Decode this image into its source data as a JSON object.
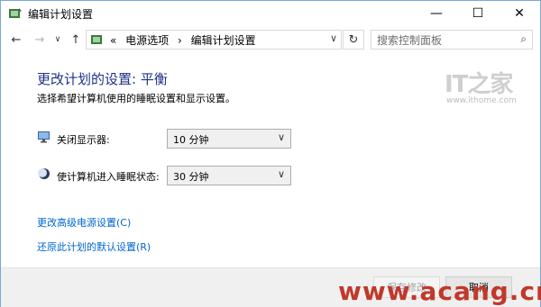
{
  "window": {
    "title": "编辑计划设置",
    "minimize_glyph": "—",
    "maximize_glyph": "☐",
    "close_glyph": "✕"
  },
  "nav": {
    "back": "←",
    "forward": "→",
    "recent": "∨",
    "up": "↑",
    "address_sep": "«",
    "crumb1": "电源选项",
    "crumb_arrow": "›",
    "crumb2": "编辑计划设置",
    "address_dropdown": "∨",
    "refresh": "↻",
    "search_placeholder": "搜索控制面板",
    "search_icon": "⌕"
  },
  "main": {
    "heading": "更改计划的设置: 平衡",
    "subtitle": "选择希望计算机使用的睡眠设置和显示设置。",
    "rows": [
      {
        "label": "关闭显示器:",
        "value": "10 分钟",
        "icon": "display-icon"
      },
      {
        "label": "使计算机进入睡眠状态:",
        "value": "30 分钟",
        "icon": "moon-icon"
      }
    ],
    "chevron": "∨",
    "link_advanced": "更改高级电源设置(C)",
    "link_restore": "还原此计划的默认设置(R)"
  },
  "footer": {
    "save_label": "保存修改",
    "cancel_label": "取消"
  },
  "watermarks": {
    "ithome_logo": "IT之家",
    "ithome_url": "www.ithome.com",
    "acang": "www.acang.cn"
  }
}
